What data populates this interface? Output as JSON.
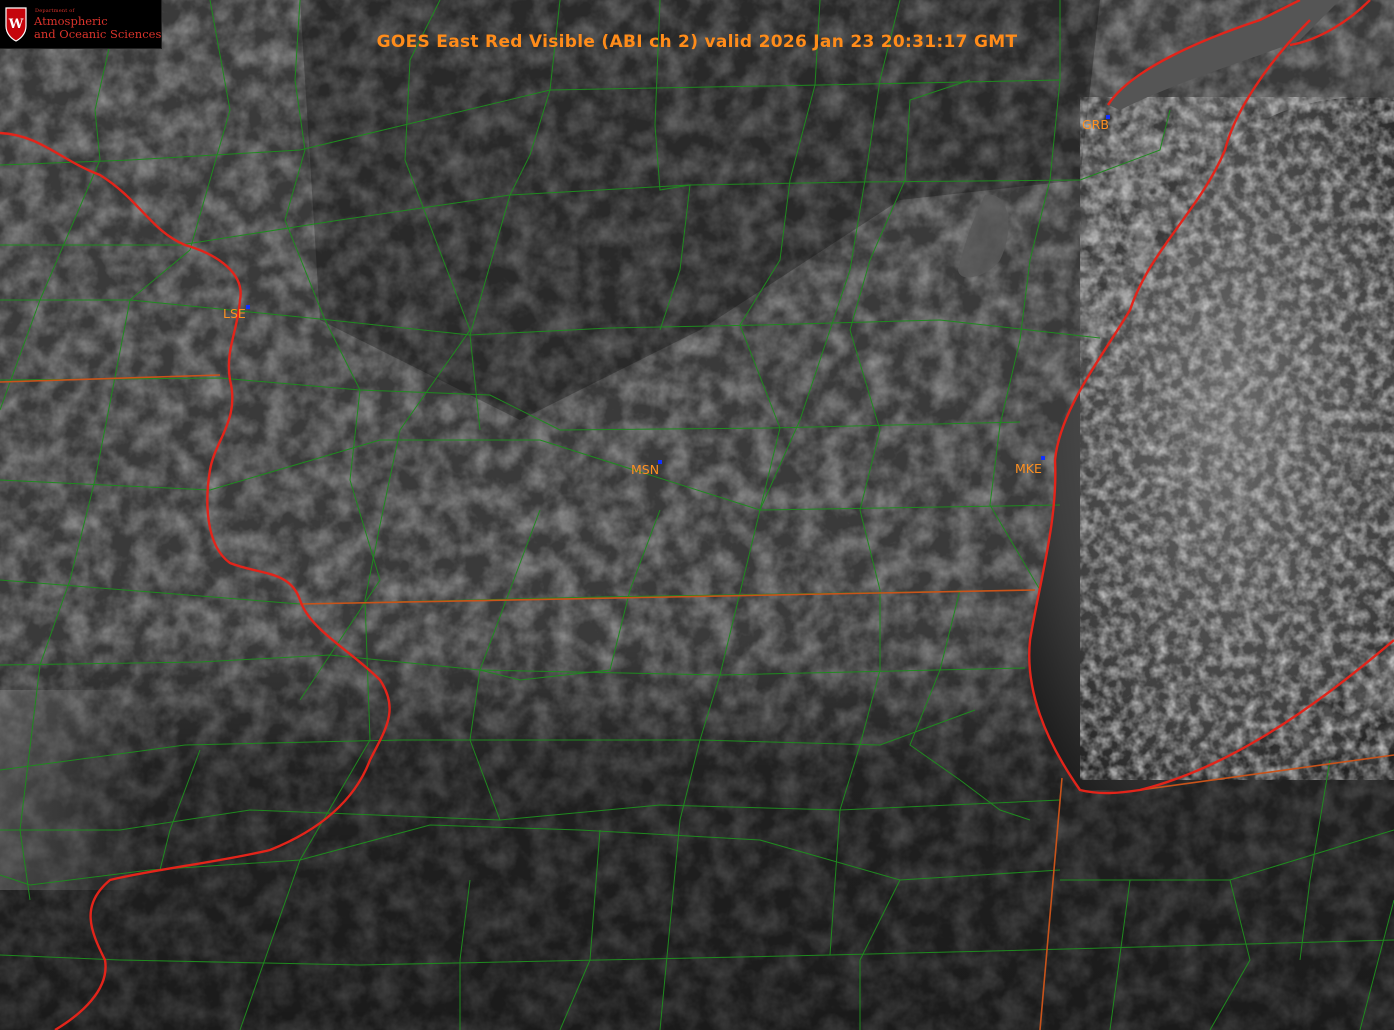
{
  "logo": {
    "department": "Department of",
    "name_line1": "Atmospheric",
    "name_line2": "and Oceanic Sciences",
    "crest_letter": "W",
    "crest_icon": "uw-crest-icon",
    "color": "#d9332b"
  },
  "title": {
    "text": "GOES East Red Visible (ABI ch 2) valid 2026 Jan 23 20:31:17 GMT",
    "color": "#ff8c1a"
  },
  "stations": [
    {
      "id": "GRB",
      "label": "GRB"
    },
    {
      "id": "LSE",
      "label": "LSE"
    },
    {
      "id": "MSN",
      "label": "MSN"
    },
    {
      "id": "MKE",
      "label": "MKE"
    }
  ],
  "colors": {
    "county_border": "#1f8a1f",
    "state_border": "#c9531a",
    "coast_river": "#e3241a",
    "station_marker": "#1030ff",
    "station_label": "#ff9020"
  }
}
